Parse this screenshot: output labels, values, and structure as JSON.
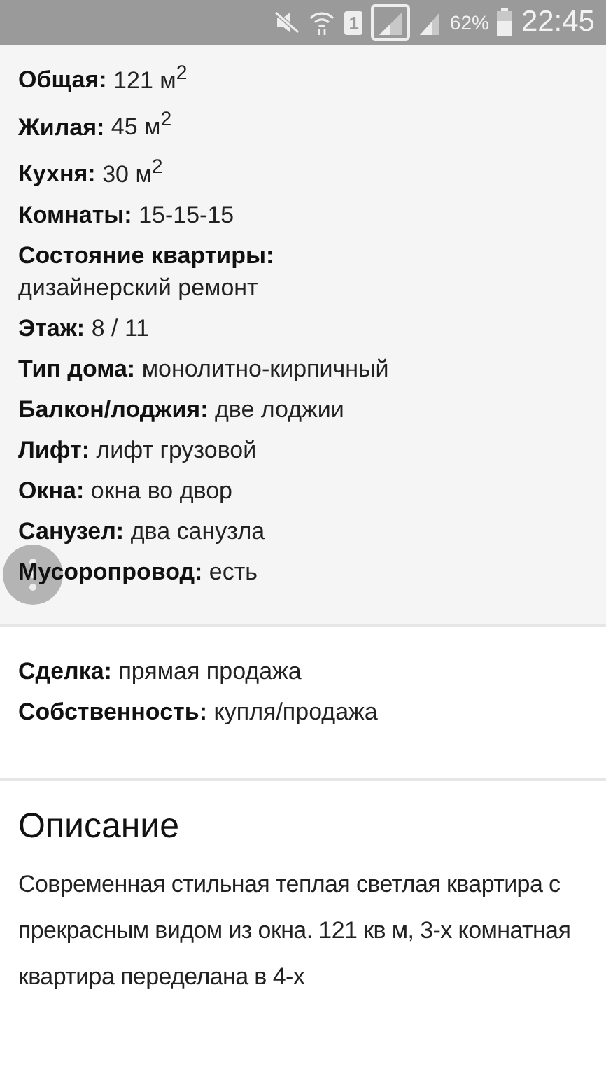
{
  "status_bar": {
    "sim": "1",
    "battery_text": "62%",
    "time": "22:45"
  },
  "floating_button": {
    "kind": "more"
  },
  "sections": [
    {
      "kind": "params",
      "items": [
        {
          "label": "Общая:",
          "value": "121 м$^{2}$",
          "kind": "inline"
        },
        {
          "label": "Жилая:",
          "value": "45 м$^{2}$",
          "kind": "inline"
        },
        {
          "label": "Кухня:",
          "value": "30 м$^{2}$",
          "kind": "inline"
        },
        {
          "label": "Комнаты:",
          "value": "15-15-15",
          "kind": "inline"
        },
        {
          "label": "Состояние квартиры:",
          "value": "дизайнерский ремонт",
          "kind": "stacked"
        },
        {
          "label": "Этаж:",
          "value": "8 / 11",
          "kind": "inline"
        },
        {
          "label": "Тип дома:",
          "value": "монолитно-кирпичный",
          "kind": "inline"
        },
        {
          "label": "Балкон/лоджия:",
          "value": "две лоджии",
          "kind": "inline"
        },
        {
          "label": "Лифт:",
          "value": "лифт грузовой",
          "kind": "inline"
        },
        {
          "label": "Окна:",
          "value": "окна во двор",
          "kind": "inline"
        },
        {
          "label": "Санузел:",
          "value": "два санузла",
          "kind": "inline"
        },
        {
          "label": "Мусоропровод:",
          "value": "есть",
          "kind": "inline"
        }
      ]
    },
    {
      "kind": "deal",
      "items": [
        {
          "label": "Сделка:",
          "value": "прямая продажа",
          "kind": "inline"
        },
        {
          "label": "Собственность:",
          "value": "купля/продажа",
          "kind": "inline"
        }
      ]
    },
    {
      "kind": "description",
      "title": "Описание",
      "text": "Современная стильная теплая светлая квартира с прекрасным видом из окна. 121 кв м, 3-х комнатная квартира переделана в 4-х"
    }
  ]
}
